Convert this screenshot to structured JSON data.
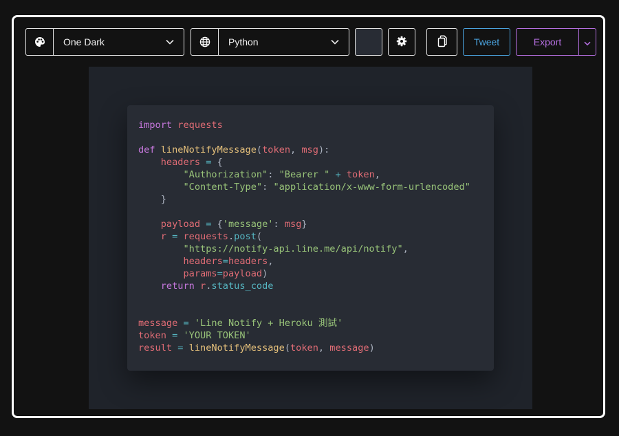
{
  "toolbar": {
    "theme_icon": "palette-icon",
    "theme_value": "One Dark",
    "language_icon": "globe-icon",
    "language_value": "Python",
    "background_color": "#282c34",
    "settings_icon": "gear-icon",
    "copy_icon": "copy-icon",
    "tweet_label": "Tweet",
    "export_label": "Export",
    "export_caret_icon": "chevron-down-icon"
  },
  "colors": {
    "keyword": "#c678dd",
    "function": "#e5c07b",
    "variable": "#e06c75",
    "string": "#98c379",
    "operator": "#56b6c2",
    "tweet": "#4aa3df",
    "export": "#b56fe0",
    "editor_bg": "#282c34"
  },
  "code": {
    "lines": [
      [
        {
          "t": "import",
          "c": "kw"
        },
        {
          "t": " "
        },
        {
          "t": "requests",
          "c": "var"
        }
      ],
      [],
      [
        {
          "t": "def",
          "c": "kw"
        },
        {
          "t": " "
        },
        {
          "t": "lineNotifyMessage",
          "c": "fn"
        },
        {
          "t": "("
        },
        {
          "t": "token",
          "c": "var"
        },
        {
          "t": ", "
        },
        {
          "t": "msg",
          "c": "var"
        },
        {
          "t": "):"
        }
      ],
      [
        {
          "t": "    "
        },
        {
          "t": "headers",
          "c": "var"
        },
        {
          "t": " "
        },
        {
          "t": "=",
          "c": "op"
        },
        {
          "t": " {"
        }
      ],
      [
        {
          "t": "        "
        },
        {
          "t": "\"Authorization\"",
          "c": "str"
        },
        {
          "t": ": "
        },
        {
          "t": "\"Bearer \"",
          "c": "str"
        },
        {
          "t": " "
        },
        {
          "t": "+",
          "c": "op"
        },
        {
          "t": " "
        },
        {
          "t": "token",
          "c": "var"
        },
        {
          "t": ","
        }
      ],
      [
        {
          "t": "        "
        },
        {
          "t": "\"Content-Type\"",
          "c": "str"
        },
        {
          "t": ": "
        },
        {
          "t": "\"application/x-www-form-urlencoded\"",
          "c": "str"
        }
      ],
      [
        {
          "t": "    }"
        }
      ],
      [],
      [
        {
          "t": "    "
        },
        {
          "t": "payload",
          "c": "var"
        },
        {
          "t": " "
        },
        {
          "t": "=",
          "c": "op"
        },
        {
          "t": " {"
        },
        {
          "t": "'message'",
          "c": "str"
        },
        {
          "t": ": "
        },
        {
          "t": "msg",
          "c": "var"
        },
        {
          "t": "}"
        }
      ],
      [
        {
          "t": "    "
        },
        {
          "t": "r",
          "c": "var"
        },
        {
          "t": " "
        },
        {
          "t": "=",
          "c": "op"
        },
        {
          "t": " "
        },
        {
          "t": "requests",
          "c": "var"
        },
        {
          "t": "."
        },
        {
          "t": "post",
          "c": "prop"
        },
        {
          "t": "("
        }
      ],
      [
        {
          "t": "        "
        },
        {
          "t": "\"https://notify-api.line.me/api/notify\"",
          "c": "str"
        },
        {
          "t": ","
        }
      ],
      [
        {
          "t": "        "
        },
        {
          "t": "headers",
          "c": "var"
        },
        {
          "t": "=",
          "c": "op"
        },
        {
          "t": "headers",
          "c": "var"
        },
        {
          "t": ","
        }
      ],
      [
        {
          "t": "        "
        },
        {
          "t": "params",
          "c": "var"
        },
        {
          "t": "=",
          "c": "op"
        },
        {
          "t": "payload",
          "c": "var"
        },
        {
          "t": ")"
        }
      ],
      [
        {
          "t": "    "
        },
        {
          "t": "return",
          "c": "kw"
        },
        {
          "t": " "
        },
        {
          "t": "r",
          "c": "var"
        },
        {
          "t": "."
        },
        {
          "t": "status_code",
          "c": "prop"
        }
      ],
      [],
      [],
      [
        {
          "t": "message",
          "c": "var"
        },
        {
          "t": " "
        },
        {
          "t": "=",
          "c": "op"
        },
        {
          "t": " "
        },
        {
          "t": "'Line Notify + Heroku 測試'",
          "c": "str"
        }
      ],
      [
        {
          "t": "token",
          "c": "var"
        },
        {
          "t": " "
        },
        {
          "t": "=",
          "c": "op"
        },
        {
          "t": " "
        },
        {
          "t": "'YOUR TOKEN'",
          "c": "str"
        }
      ],
      [
        {
          "t": "result",
          "c": "var"
        },
        {
          "t": " "
        },
        {
          "t": "=",
          "c": "op"
        },
        {
          "t": " "
        },
        {
          "t": "lineNotifyMessage",
          "c": "fn"
        },
        {
          "t": "("
        },
        {
          "t": "token",
          "c": "var"
        },
        {
          "t": ", "
        },
        {
          "t": "message",
          "c": "var"
        },
        {
          "t": ")"
        }
      ]
    ]
  }
}
